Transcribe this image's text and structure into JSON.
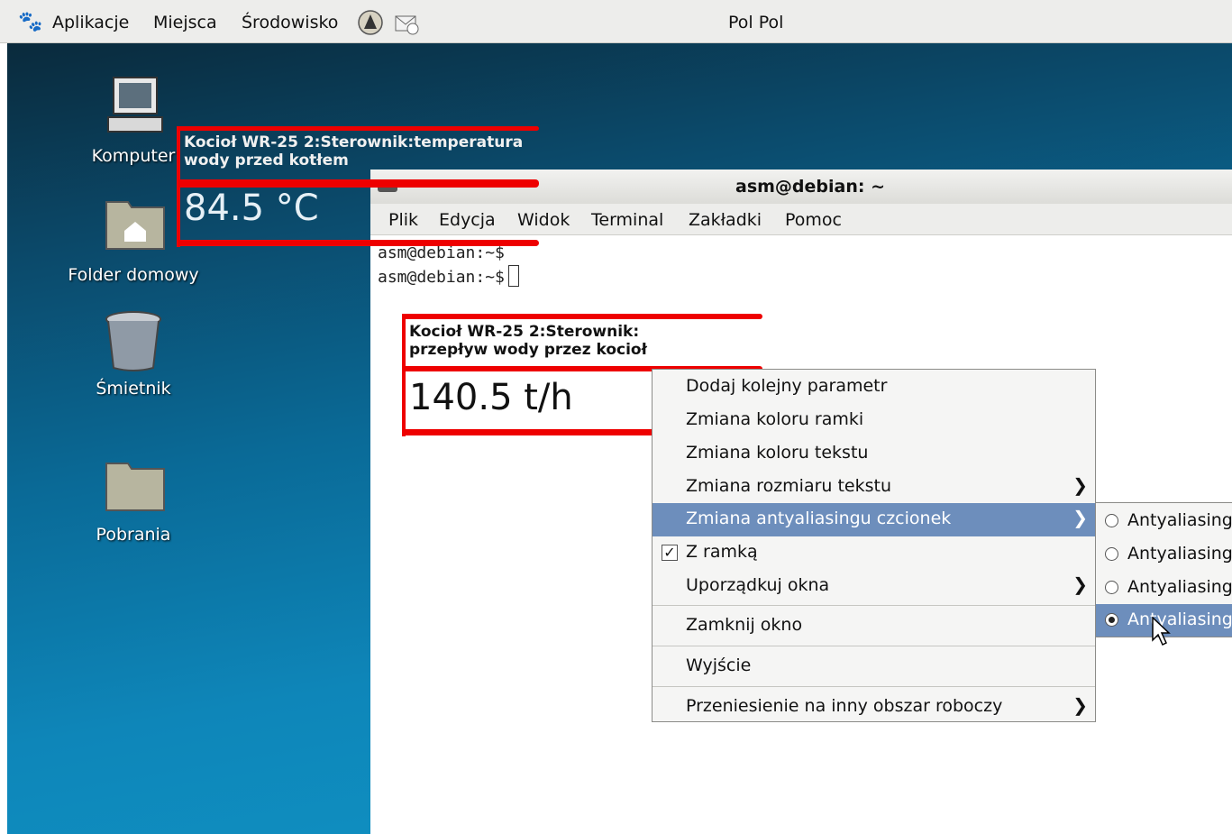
{
  "panel": {
    "menus": [
      "Aplikacje",
      "Miejsca",
      "Środowisko"
    ],
    "user": "Pol Pol"
  },
  "desktop": {
    "icons": [
      {
        "label": "Komputer"
      },
      {
        "label": "Folder domowy"
      },
      {
        "label": "Śmietnik"
      },
      {
        "label": "Pobrania"
      }
    ]
  },
  "widget1": {
    "title_line1": "Kocioł WR-25 2:Sterownik:temperatura",
    "title_line2": "wody przed kotłem",
    "value": "84.5 °C",
    "color": "#ee0000"
  },
  "widget2": {
    "title_line1": "Kocioł WR-25 2:Sterownik:",
    "title_line2": "przepływ wody przez kocioł",
    "value": "140.5 t/h",
    "color": "#ee0000"
  },
  "terminal": {
    "title": "asm@debian: ~",
    "menus": [
      "Plik",
      "Edycja",
      "Widok",
      "Terminal",
      "Zakładki",
      "Pomoc"
    ],
    "lines": [
      "asm@debian:~$",
      "asm@debian:~$"
    ]
  },
  "context_menu": {
    "items": [
      {
        "label": "Dodaj kolejny parametr"
      },
      {
        "label": "Zmiana koloru ramki"
      },
      {
        "label": "Zmiana koloru tekstu"
      },
      {
        "label": "Zmiana rozmiaru tekstu",
        "submenu": true
      },
      {
        "label": "Zmiana antyaliasingu czcionek",
        "submenu": true,
        "highlighted": true
      },
      {
        "label": "Z ramką",
        "checked": true
      },
      {
        "label": "Uporządkuj okna",
        "submenu": true
      },
      {
        "label": "Zamknij okno"
      },
      {
        "label": "Wyjście"
      },
      {
        "label": "Przeniesienie na inny obszar roboczy",
        "submenu": true
      }
    ]
  },
  "submenu": {
    "options": [
      {
        "label": "Antyaliasing",
        "selected": false
      },
      {
        "label": "Antyaliasing",
        "selected": false
      },
      {
        "label": "Antyaliasing",
        "selected": false
      },
      {
        "label": "Antyaliasing",
        "selected": true,
        "highlighted": true
      }
    ]
  },
  "colors": {
    "highlight": "#6d8ebc",
    "widget_border": "#ee0000"
  }
}
